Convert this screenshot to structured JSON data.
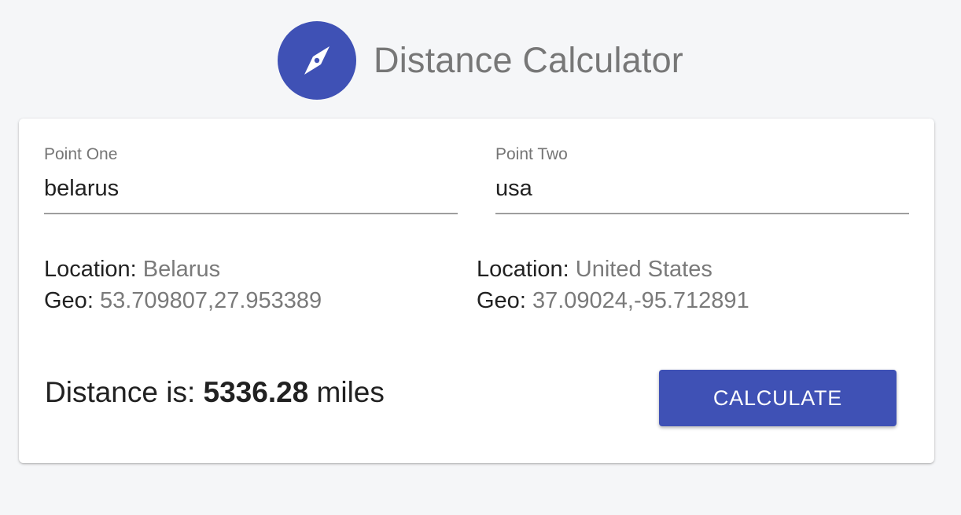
{
  "header": {
    "title": "Distance Calculator",
    "icon": "compass-icon"
  },
  "colors": {
    "primary": "#3f51b5",
    "muted_text": "#7a7a7a"
  },
  "point_one": {
    "label": "Point One",
    "value": "belarus",
    "location_label": "Location:",
    "location_value": "Belarus",
    "geo_label": "Geo:",
    "geo_value": "53.709807,27.953389"
  },
  "point_two": {
    "label": "Point Two",
    "value": "usa",
    "location_label": "Location:",
    "location_value": "United States",
    "geo_label": "Geo:",
    "geo_value": "37.09024,-95.712891"
  },
  "result": {
    "prefix": "Distance is:",
    "value": "5336.28",
    "unit": "miles"
  },
  "actions": {
    "calculate_label": "CALCULATE"
  }
}
